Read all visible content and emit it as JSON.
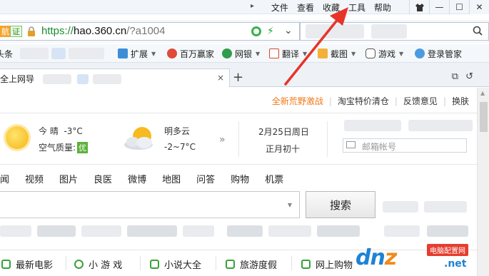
{
  "menubar": {
    "items": [
      "文件",
      "查看",
      "收藏",
      "工具",
      "帮助"
    ]
  },
  "addressbar": {
    "badge1": "航",
    "badge2": "证",
    "url_scheme": "https://",
    "url_host": "hao.360.cn",
    "url_path": "/?a1004"
  },
  "favorites": {
    "items": [
      {
        "label": "头条"
      },
      {
        "label": "扩展"
      },
      {
        "label": "百万赢家"
      },
      {
        "label": "网银"
      },
      {
        "label": "翻译"
      },
      {
        "label": "截图"
      },
      {
        "label": "游戏"
      },
      {
        "label": "登录管家"
      }
    ]
  },
  "tabs": {
    "active_label": "全上网导",
    "close": "×",
    "new_tab": "+"
  },
  "page": {
    "toplinks": [
      "全新荒野激战",
      "淘宝特价清仓",
      "反馈意见",
      "换肤"
    ],
    "weather": {
      "today_cond": "今 晴",
      "today_temp": "-3°C",
      "aqi_label": "空气质量:",
      "aqi_value": "优",
      "tomorrow_cond": "明多云",
      "tomorrow_temp": "-2~7°C",
      "more": "»"
    },
    "date": {
      "solar": "2月25日周日",
      "lunar": "正月初十"
    },
    "mail_placeholder": "邮箱帐号",
    "search_tabs": [
      "闻",
      "视频",
      "图片",
      "良医",
      "微博",
      "地图",
      "问答",
      "购物",
      "机票"
    ],
    "search_button": "搜索",
    "categories": [
      {
        "label": "最新电影",
        "color": "#3aa03a"
      },
      {
        "label": "小 游 戏",
        "color": "#3aa03a"
      },
      {
        "label": "小说大全",
        "color": "#3aa03a"
      },
      {
        "label": "旅游度假",
        "color": "#3aa03a"
      },
      {
        "label": "网上购物",
        "color": "#3aa03a"
      }
    ]
  },
  "watermark": {
    "text_left": "dn",
    "text_z": "z",
    "tag": "电脑配置网",
    "net": ".net"
  },
  "colors": {
    "accent_orange": "#f07815",
    "url_green": "#1c8a34",
    "annotation_red": "#e8332a",
    "aqi_green": "#5bb13a"
  }
}
